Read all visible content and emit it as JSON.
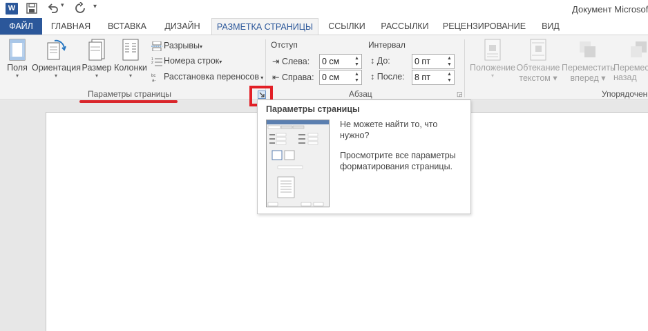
{
  "titlebar": {
    "app_icon": "W",
    "document_title": "Документ Microsoft"
  },
  "tabs": [
    {
      "label": "ФАЙЛ"
    },
    {
      "label": "ГЛАВНАЯ"
    },
    {
      "label": "ВСТАВКА"
    },
    {
      "label": "ДИЗАЙН"
    },
    {
      "label": "РАЗМЕТКА СТРАНИЦЫ"
    },
    {
      "label": "ССЫЛКИ"
    },
    {
      "label": "РАССЫЛКИ"
    },
    {
      "label": "РЕЦЕНЗИРОВАНИЕ"
    },
    {
      "label": "ВИД"
    }
  ],
  "page_setup": {
    "fields_label": "Поля",
    "orientation_label": "Ориентация",
    "size_label": "Размер",
    "columns_label": "Колонки",
    "breaks_label": "Разрывы",
    "line_numbers_label": "Номера строк",
    "hyphenation_label": "Расстановка переносов",
    "group_label": "Параметры страницы"
  },
  "paragraph": {
    "indent_header": "Отступ",
    "spacing_header": "Интервал",
    "left_label": "Слева:",
    "right_label": "Справа:",
    "before_label": "До:",
    "after_label": "После:",
    "left_value": "0 см",
    "right_value": "0 см",
    "before_value": "0 пт",
    "after_value": "8 пт",
    "group_label": "Абзац"
  },
  "arrange": {
    "position_label": "Положение",
    "wrap_label_1": "Обтекание",
    "wrap_label_2": "текстом",
    "forward_label_1": "Переместить",
    "forward_label_2": "вперед",
    "backward_label_1": "Перемест",
    "backward_label_2": "назад",
    "group_label": "Упорядочен"
  },
  "tooltip": {
    "title": "Параметры страницы",
    "text1": "Не можете найти то, что нужно?",
    "text2": "Просмотрите все параметры форматирования страницы."
  },
  "colors": {
    "accent": "#2b579a",
    "highlight": "#e21f26"
  }
}
